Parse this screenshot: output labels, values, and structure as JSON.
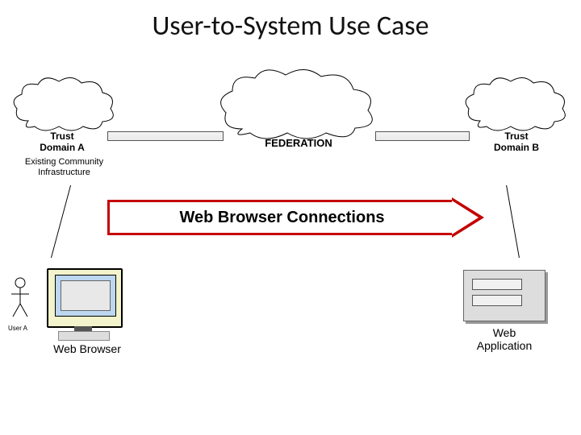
{
  "title": "User-to-System Use Case",
  "clouds": {
    "a": {
      "label": "Trust\nDomain A",
      "infra": "Existing Community\nInfrastructure"
    },
    "federation": {
      "label": "FEDERATION"
    },
    "b": {
      "label": "Trust\nDomain B"
    }
  },
  "arrow": {
    "label": "Web Browser Connections"
  },
  "left": {
    "user": "User A",
    "browser": "Web Browser"
  },
  "right": {
    "app": "Web\nApplication"
  }
}
